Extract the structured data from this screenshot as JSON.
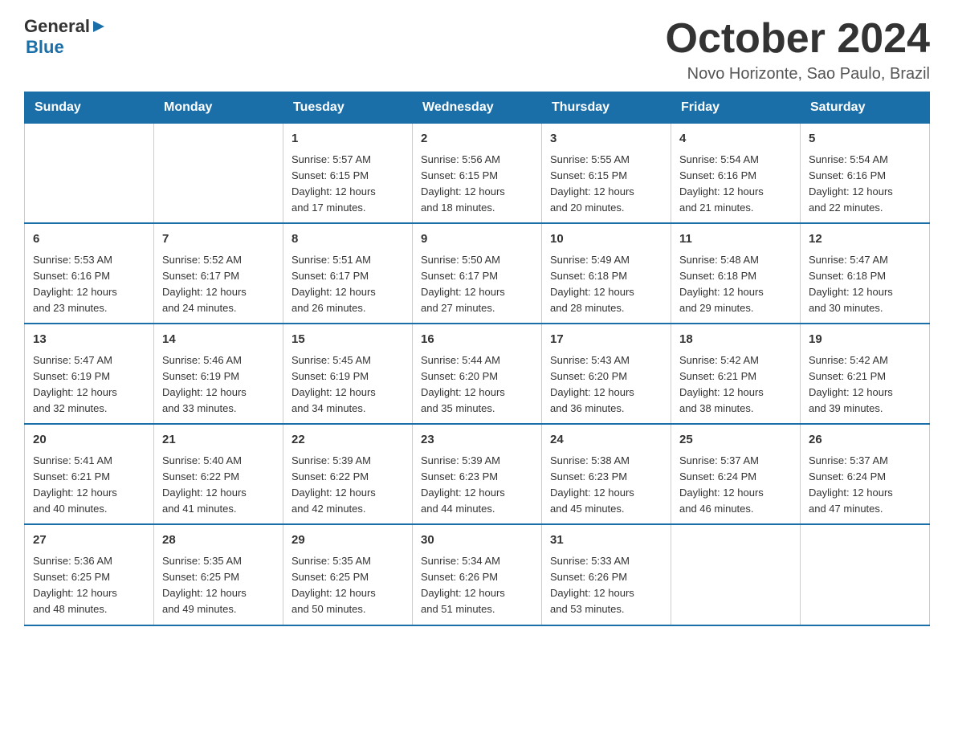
{
  "header": {
    "logo_general": "General",
    "logo_blue": "Blue",
    "title": "October 2024",
    "location": "Novo Horizonte, Sao Paulo, Brazil"
  },
  "weekdays": [
    "Sunday",
    "Monday",
    "Tuesday",
    "Wednesday",
    "Thursday",
    "Friday",
    "Saturday"
  ],
  "weeks": [
    [
      {
        "day": "",
        "info": ""
      },
      {
        "day": "",
        "info": ""
      },
      {
        "day": "1",
        "info": "Sunrise: 5:57 AM\nSunset: 6:15 PM\nDaylight: 12 hours\nand 17 minutes."
      },
      {
        "day": "2",
        "info": "Sunrise: 5:56 AM\nSunset: 6:15 PM\nDaylight: 12 hours\nand 18 minutes."
      },
      {
        "day": "3",
        "info": "Sunrise: 5:55 AM\nSunset: 6:15 PM\nDaylight: 12 hours\nand 20 minutes."
      },
      {
        "day": "4",
        "info": "Sunrise: 5:54 AM\nSunset: 6:16 PM\nDaylight: 12 hours\nand 21 minutes."
      },
      {
        "day": "5",
        "info": "Sunrise: 5:54 AM\nSunset: 6:16 PM\nDaylight: 12 hours\nand 22 minutes."
      }
    ],
    [
      {
        "day": "6",
        "info": "Sunrise: 5:53 AM\nSunset: 6:16 PM\nDaylight: 12 hours\nand 23 minutes."
      },
      {
        "day": "7",
        "info": "Sunrise: 5:52 AM\nSunset: 6:17 PM\nDaylight: 12 hours\nand 24 minutes."
      },
      {
        "day": "8",
        "info": "Sunrise: 5:51 AM\nSunset: 6:17 PM\nDaylight: 12 hours\nand 26 minutes."
      },
      {
        "day": "9",
        "info": "Sunrise: 5:50 AM\nSunset: 6:17 PM\nDaylight: 12 hours\nand 27 minutes."
      },
      {
        "day": "10",
        "info": "Sunrise: 5:49 AM\nSunset: 6:18 PM\nDaylight: 12 hours\nand 28 minutes."
      },
      {
        "day": "11",
        "info": "Sunrise: 5:48 AM\nSunset: 6:18 PM\nDaylight: 12 hours\nand 29 minutes."
      },
      {
        "day": "12",
        "info": "Sunrise: 5:47 AM\nSunset: 6:18 PM\nDaylight: 12 hours\nand 30 minutes."
      }
    ],
    [
      {
        "day": "13",
        "info": "Sunrise: 5:47 AM\nSunset: 6:19 PM\nDaylight: 12 hours\nand 32 minutes."
      },
      {
        "day": "14",
        "info": "Sunrise: 5:46 AM\nSunset: 6:19 PM\nDaylight: 12 hours\nand 33 minutes."
      },
      {
        "day": "15",
        "info": "Sunrise: 5:45 AM\nSunset: 6:19 PM\nDaylight: 12 hours\nand 34 minutes."
      },
      {
        "day": "16",
        "info": "Sunrise: 5:44 AM\nSunset: 6:20 PM\nDaylight: 12 hours\nand 35 minutes."
      },
      {
        "day": "17",
        "info": "Sunrise: 5:43 AM\nSunset: 6:20 PM\nDaylight: 12 hours\nand 36 minutes."
      },
      {
        "day": "18",
        "info": "Sunrise: 5:42 AM\nSunset: 6:21 PM\nDaylight: 12 hours\nand 38 minutes."
      },
      {
        "day": "19",
        "info": "Sunrise: 5:42 AM\nSunset: 6:21 PM\nDaylight: 12 hours\nand 39 minutes."
      }
    ],
    [
      {
        "day": "20",
        "info": "Sunrise: 5:41 AM\nSunset: 6:21 PM\nDaylight: 12 hours\nand 40 minutes."
      },
      {
        "day": "21",
        "info": "Sunrise: 5:40 AM\nSunset: 6:22 PM\nDaylight: 12 hours\nand 41 minutes."
      },
      {
        "day": "22",
        "info": "Sunrise: 5:39 AM\nSunset: 6:22 PM\nDaylight: 12 hours\nand 42 minutes."
      },
      {
        "day": "23",
        "info": "Sunrise: 5:39 AM\nSunset: 6:23 PM\nDaylight: 12 hours\nand 44 minutes."
      },
      {
        "day": "24",
        "info": "Sunrise: 5:38 AM\nSunset: 6:23 PM\nDaylight: 12 hours\nand 45 minutes."
      },
      {
        "day": "25",
        "info": "Sunrise: 5:37 AM\nSunset: 6:24 PM\nDaylight: 12 hours\nand 46 minutes."
      },
      {
        "day": "26",
        "info": "Sunrise: 5:37 AM\nSunset: 6:24 PM\nDaylight: 12 hours\nand 47 minutes."
      }
    ],
    [
      {
        "day": "27",
        "info": "Sunrise: 5:36 AM\nSunset: 6:25 PM\nDaylight: 12 hours\nand 48 minutes."
      },
      {
        "day": "28",
        "info": "Sunrise: 5:35 AM\nSunset: 6:25 PM\nDaylight: 12 hours\nand 49 minutes."
      },
      {
        "day": "29",
        "info": "Sunrise: 5:35 AM\nSunset: 6:25 PM\nDaylight: 12 hours\nand 50 minutes."
      },
      {
        "day": "30",
        "info": "Sunrise: 5:34 AM\nSunset: 6:26 PM\nDaylight: 12 hours\nand 51 minutes."
      },
      {
        "day": "31",
        "info": "Sunrise: 5:33 AM\nSunset: 6:26 PM\nDaylight: 12 hours\nand 53 minutes."
      },
      {
        "day": "",
        "info": ""
      },
      {
        "day": "",
        "info": ""
      }
    ]
  ],
  "colors": {
    "header_bg": "#1a6fa8",
    "header_text": "#ffffff",
    "border": "#cccccc",
    "row_border": "#1a6fa8",
    "text_dark": "#333333",
    "text_blue": "#1a6fa8"
  }
}
